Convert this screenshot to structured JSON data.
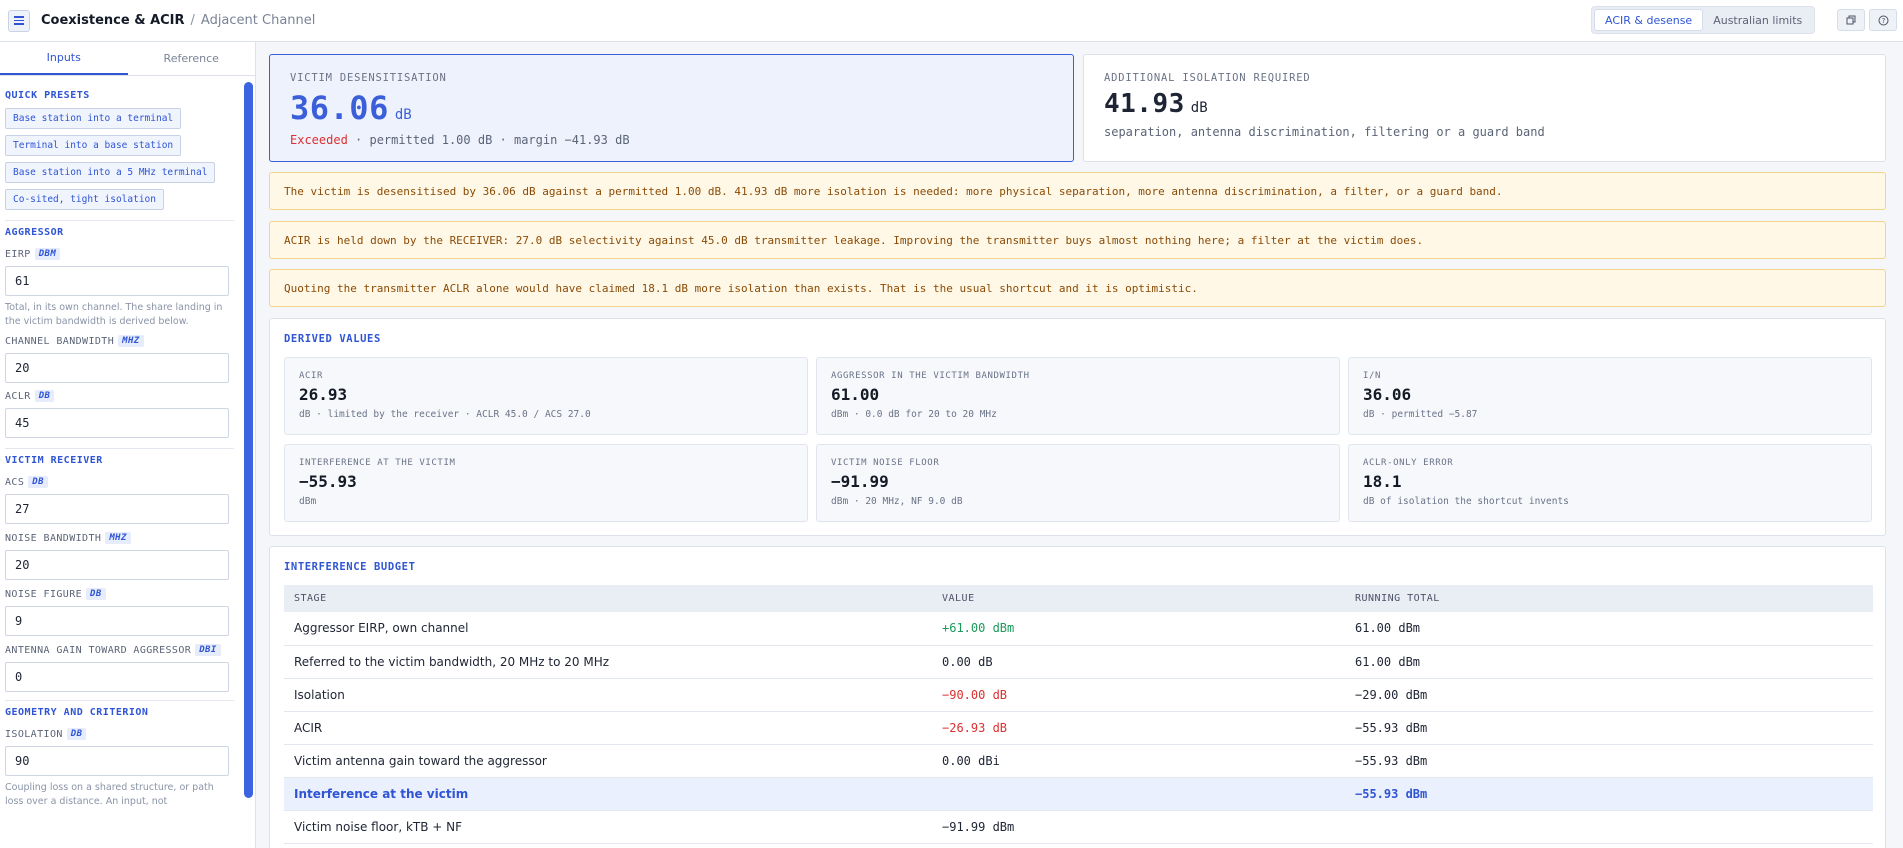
{
  "header": {
    "title": "Coexistence & ACIR",
    "separator": "/",
    "breadcrumb": "Adjacent Channel",
    "segments": [
      "ACIR & desense",
      "Australian limits"
    ]
  },
  "sidebar": {
    "tabs": [
      "Inputs",
      "Reference"
    ],
    "presets_title": "QUICK PRESETS",
    "presets": [
      "Base station into a terminal",
      "Terminal into a base station",
      "Base station into a 5 MHz terminal",
      "Co-sited, tight isolation"
    ],
    "aggressor": {
      "title": "AGGRESSOR",
      "eirp": {
        "label": "EIRP",
        "unit": "DBM",
        "value": "61",
        "help": "Total, in its own channel. The share landing in the victim bandwidth is derived below."
      },
      "bandwidth": {
        "label": "CHANNEL BANDWIDTH",
        "unit": "MHZ",
        "value": "20"
      },
      "aclr": {
        "label": "ACLR",
        "unit": "DB",
        "value": "45"
      }
    },
    "victim": {
      "title": "VICTIM RECEIVER",
      "acs": {
        "label": "ACS",
        "unit": "DB",
        "value": "27"
      },
      "noise_bw": {
        "label": "NOISE BANDWIDTH",
        "unit": "MHZ",
        "value": "20"
      },
      "nf": {
        "label": "NOISE FIGURE",
        "unit": "DB",
        "value": "9"
      },
      "gain": {
        "label": "ANTENNA GAIN TOWARD AGGRESSOR",
        "unit": "DBI",
        "value": "0"
      }
    },
    "geometry": {
      "title": "GEOMETRY AND CRITERION",
      "isolation": {
        "label": "ISOLATION",
        "unit": "DB",
        "value": "90",
        "help": "Coupling loss on a shared structure, or path loss over a distance. An input, not"
      }
    }
  },
  "kpi": {
    "desense": {
      "label": "VICTIM DESENSITISATION",
      "value": "36.06",
      "unit": "dB",
      "status": "Exceeded",
      "detail": " · permitted 1.00 dB · margin −41.93 dB"
    },
    "isolation": {
      "label": "ADDITIONAL ISOLATION REQUIRED",
      "value": "41.93",
      "unit": "dB",
      "detail": "separation, antenna discrimination, filtering or a guard band"
    }
  },
  "alerts": [
    "The victim is desensitised by 36.06 dB against a permitted 1.00 dB. 41.93 dB more isolation is needed: more physical separation, more antenna discrimination, a filter, or a guard band.",
    "ACIR is held down by the RECEIVER: 27.0 dB selectivity against 45.0 dB transmitter leakage. Improving the transmitter buys almost nothing here; a filter at the victim does.",
    "Quoting the transmitter ACLR alone would have claimed 18.1 dB more isolation than exists. That is the usual shortcut and it is optimistic."
  ],
  "derived": {
    "title": "DERIVED VALUES",
    "cells": [
      {
        "label": "ACIR",
        "value": "26.93",
        "sub": "dB · limited by the receiver · ACLR 45.0 / ACS 27.0"
      },
      {
        "label": "AGGRESSOR IN THE VICTIM BANDWIDTH",
        "value": "61.00",
        "sub": "dBm · 0.0 dB for 20 to 20 MHz"
      },
      {
        "label": "I/N",
        "value": "36.06",
        "sub": "dB · permitted −5.87"
      },
      {
        "label": "INTERFERENCE AT THE VICTIM",
        "value": "−55.93",
        "sub": "dBm"
      },
      {
        "label": "VICTIM NOISE FLOOR",
        "value": "−91.99",
        "sub": "dBm · 20 MHz, NF 9.0 dB"
      },
      {
        "label": "ACLR-ONLY ERROR",
        "value": "18.1",
        "sub": "dB of isolation the shortcut invents"
      }
    ]
  },
  "budget": {
    "title": "INTERFERENCE BUDGET",
    "columns": [
      "STAGE",
      "VALUE",
      "RUNNING TOTAL"
    ],
    "rows": [
      {
        "stage": "Aggressor EIRP, own channel",
        "value": "+61.00 dBm",
        "total": "61.00 dBm"
      },
      {
        "stage": "Referred to the victim bandwidth, 20 MHz to 20 MHz",
        "value": "0.00 dB",
        "total": "61.00 dBm"
      },
      {
        "stage": "Isolation",
        "value": "−90.00 dB",
        "total": "−29.00 dBm"
      },
      {
        "stage": "ACIR",
        "value": "−26.93 dB",
        "total": "−55.93 dBm"
      },
      {
        "stage": "Victim antenna gain toward the aggressor",
        "value": "0.00 dBi",
        "total": "−55.93 dBm"
      },
      {
        "stage": "Interference at the victim",
        "value": "",
        "total": "−55.93 dBm"
      },
      {
        "stage": "Victim noise floor, kTB + NF",
        "value": "−91.99 dBm",
        "total": ""
      }
    ]
  }
}
